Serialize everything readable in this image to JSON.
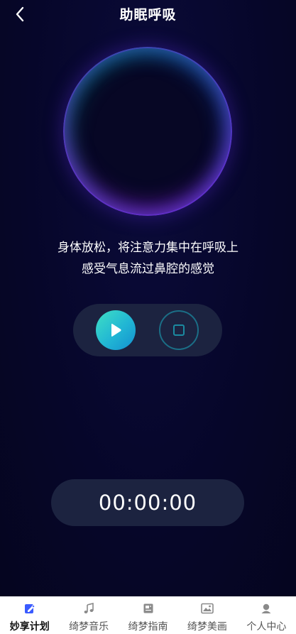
{
  "header": {
    "title": "助眠呼吸",
    "back_icon": "chevron-left-icon"
  },
  "breathing": {
    "instruction_line1": "身体放松，将注意力集中在呼吸上",
    "instruction_line2": "感受气息流过鼻腔的感觉"
  },
  "controls": {
    "play_icon": "play-icon",
    "stop_icon": "stop-icon"
  },
  "timer": {
    "value": "00:00:00"
  },
  "tabbar": {
    "items": [
      {
        "label": "妙享计划",
        "icon": "edit-icon",
        "active": true
      },
      {
        "label": "绮梦音乐",
        "icon": "music-note-icon",
        "active": false
      },
      {
        "label": "绮梦指南",
        "icon": "guide-icon",
        "active": false
      },
      {
        "label": "绮梦美画",
        "icon": "picture-icon",
        "active": false
      },
      {
        "label": "个人中心",
        "icon": "user-icon",
        "active": false
      }
    ]
  },
  "colors": {
    "background": "#060629",
    "pill": "#1c2340",
    "accent": "#2ac8cf",
    "tab_active": "#3a5bff"
  }
}
